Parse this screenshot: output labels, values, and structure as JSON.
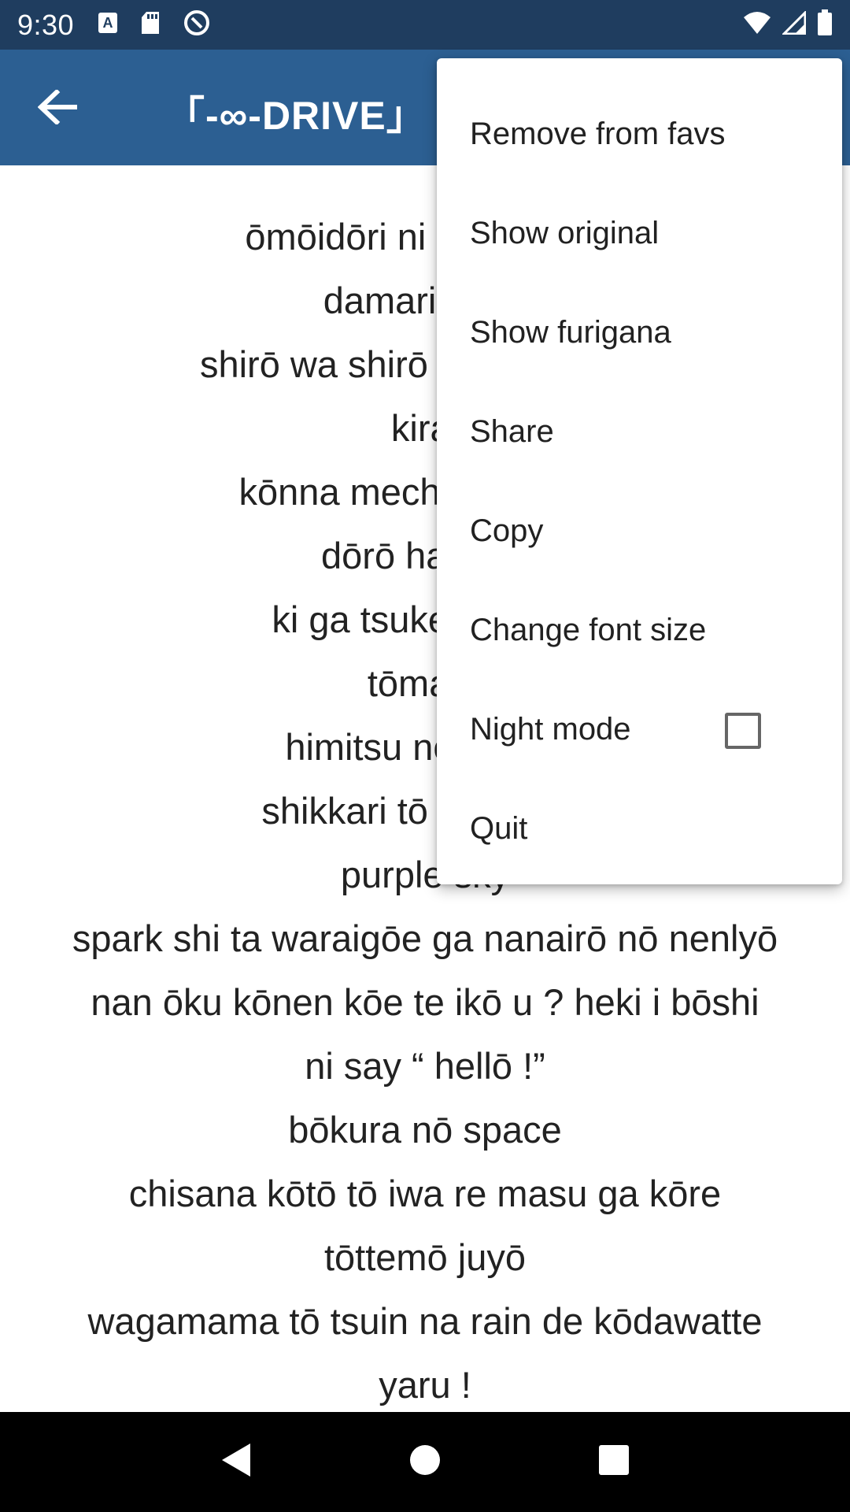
{
  "status_bar": {
    "time": "9:30",
    "left_icons": [
      "a-notification-icon",
      "sd-card-icon",
      "sync-icon"
    ],
    "right_icons": [
      "wifi-icon",
      "signal-icon",
      "battery-icon"
    ]
  },
  "app_bar": {
    "back_icon": "arrow-back-icon",
    "title": "「-∞-DRIVE」"
  },
  "lyrics": [
    "ōmōidōri ni ika nai mō",
    "damarikomu",
    "shirō wa shirō kurō wa kurō",
    "kirai",
    "kōnna mechakucha na",
    "dōrō hane te",
    "ki ga tsuke ba kiirō",
    "tōmaru",
    "himitsu nō gia de",
    "shikkari tō tsukamat",
    "purple sky",
    "spark shi ta waraigōe ga nanairō nō nenlyō",
    "nan ōku kōnen kōe te ikō u ?  heki i bōshi",
    "ni say “ hellō !”",
    "bōkura nō space",
    "chisana kōtō tō iwa re masu ga kōre",
    "tōttemō juyō",
    "wagamama tō tsuin na rain de kōdawatte",
    "yaru !"
  ],
  "menu": {
    "items": [
      {
        "label": "Remove from favs"
      },
      {
        "label": "Show original"
      },
      {
        "label": "Show furigana"
      },
      {
        "label": "Share"
      },
      {
        "label": "Copy"
      },
      {
        "label": "Change font size"
      },
      {
        "label": "Night mode",
        "checked": false
      },
      {
        "label": "Quit"
      }
    ]
  },
  "nav_bar": {
    "icons": [
      "back-triangle-icon",
      "home-circle-icon",
      "recents-square-icon"
    ]
  },
  "colors": {
    "status_bar": "#1f3d5f",
    "app_bar": "#2c5f92",
    "text": "#222222",
    "nav_bar": "#000000"
  }
}
